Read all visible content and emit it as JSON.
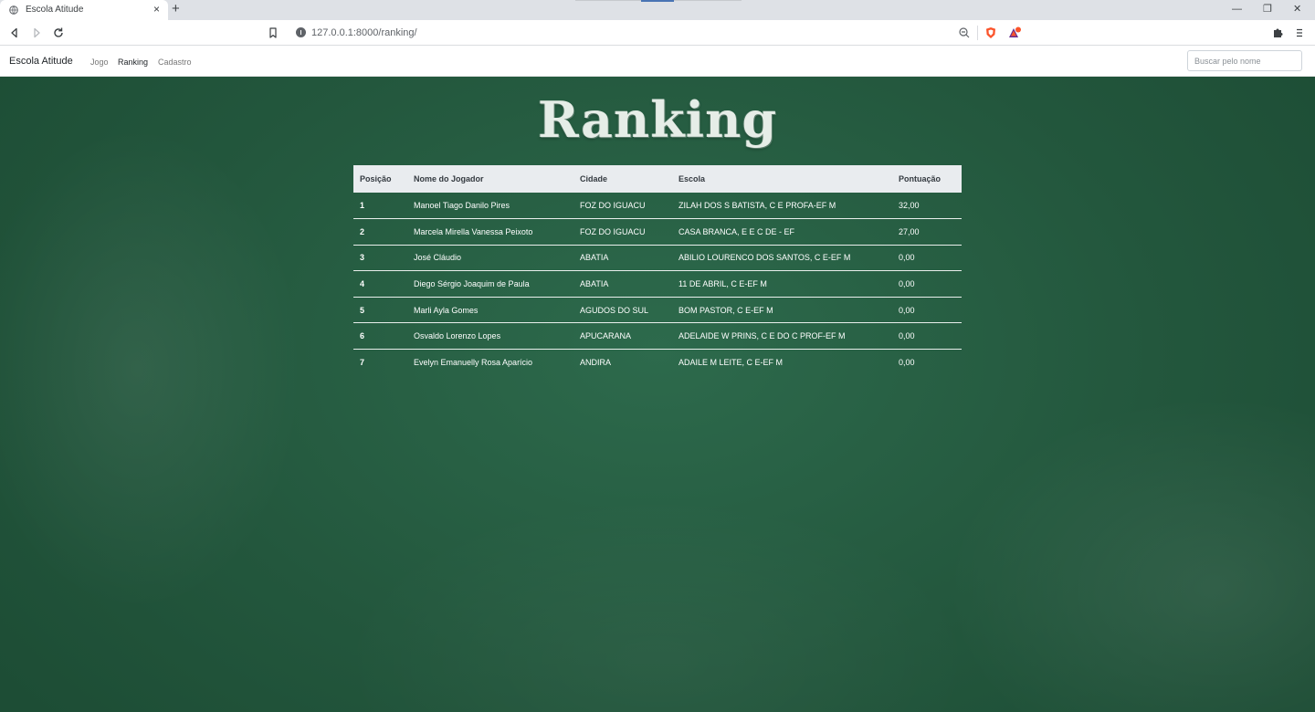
{
  "browser": {
    "tab_title": "Escola Atitude",
    "tab_close": "×",
    "new_tab": "+",
    "url": "127.0.0.1:8000/ranking/",
    "window_minimize": "—",
    "window_restore": "❐",
    "window_close": "✕"
  },
  "navbar": {
    "brand": "Escola Atitude",
    "links": [
      "Jogo",
      "Ranking",
      "Cadastro"
    ],
    "active_link": "Ranking",
    "search_placeholder": "Buscar pelo nome"
  },
  "page": {
    "title": "Ranking"
  },
  "table": {
    "headers": [
      "Posição",
      "Nome do Jogador",
      "Cidade",
      "Escola",
      "Pontuação"
    ],
    "rows": [
      [
        "1",
        "Manoel Tiago Danilo Pires",
        "FOZ DO IGUACU",
        "ZILAH DOS S BATISTA, C E PROFA-EF M",
        "32,00"
      ],
      [
        "2",
        "Marcela Mirella Vanessa Peixoto",
        "FOZ DO IGUACU",
        "CASA BRANCA, E E C DE - EF",
        "27,00"
      ],
      [
        "3",
        "José Cláudio",
        "ABATIA",
        "ABILIO LOURENCO DOS SANTOS, C E-EF M",
        "0,00"
      ],
      [
        "4",
        "Diego Sérgio Joaquim de Paula",
        "ABATIA",
        "11 DE ABRIL, C E-EF M",
        "0,00"
      ],
      [
        "5",
        "Marli Ayla Gomes",
        "AGUDOS DO SUL",
        "BOM PASTOR, C E-EF M",
        "0,00"
      ],
      [
        "6",
        "Osvaldo Lorenzo Lopes",
        "APUCARANA",
        "ADELAIDE W PRINS, C E DO C PROF-EF M",
        "0,00"
      ],
      [
        "7",
        "Evelyn Emanuelly Rosa Aparício",
        "ANDIRA",
        "ADAILE M LEITE, C E-EF M",
        "0,00"
      ]
    ]
  },
  "colors": {
    "board": "#2d6a4c",
    "header_bg": "#e9ecef",
    "brave_orange": "#fb542b"
  }
}
